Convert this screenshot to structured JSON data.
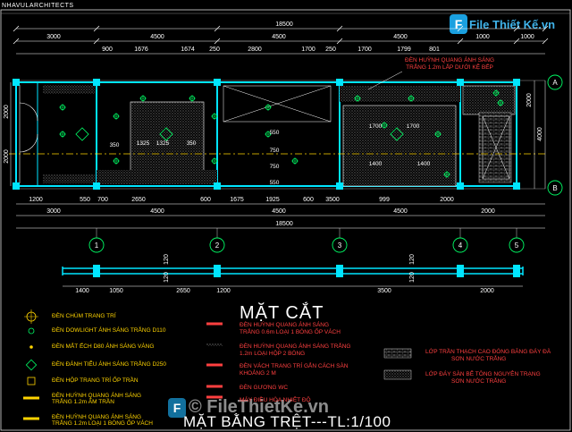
{
  "header": {
    "firm": "NHAVULARCHITECTS"
  },
  "logo": {
    "mark": "F",
    "text": "File Thiết Kế.vn"
  },
  "watermark": {
    "text": "© FileThietKe.vn",
    "mark": "F"
  },
  "titles": {
    "section": "MẶT CẮT",
    "plan": "MẶT BẰNG TRỆT---TL:1/100"
  },
  "note": {
    "line1": "ĐÈN HUỲNH QUANG ÁNH SÁNG",
    "line2": "TRẮNG 1.2m LẮP DƯỚI KỆ BẾP"
  },
  "dims": {
    "top_total": "18500",
    "top_row": [
      "3000",
      "4500",
      "4500",
      "4500",
      "1000",
      "1000"
    ],
    "top_sub": [
      "900",
      "1676",
      "1674",
      "250",
      "2800",
      "1700",
      "250",
      "1700",
      "1799",
      "801"
    ],
    "right": [
      "2000",
      "4000"
    ],
    "left": [
      "2000",
      "2000"
    ],
    "bot_row1": [
      "1200",
      "550",
      "700",
      "2650",
      "600",
      "1675",
      "1925",
      "600",
      "3500",
      "999",
      "2000"
    ],
    "bot_row2": [
      "3000",
      "4500",
      "4500",
      "4500",
      "2000"
    ],
    "bot_total": "18500",
    "inner": [
      "350",
      "1325",
      "1325",
      "350",
      "1700",
      "1700",
      "1400",
      "1400",
      "550",
      "750",
      "750",
      "550"
    ],
    "section_dims": [
      "1400",
      "1050",
      "2650",
      "1200",
      "3500",
      "2000"
    ],
    "section_vert": [
      "120",
      "120",
      "120",
      "120"
    ]
  },
  "axes": {
    "cols": [
      "1",
      "2",
      "3",
      "4",
      "5"
    ],
    "rows": [
      "A",
      "B"
    ]
  },
  "legend_left": [
    {
      "icon": "chandelier-icon",
      "text": "ĐÈN CHÙM TRANG TRÍ"
    },
    {
      "icon": "downlight-icon",
      "text": "ĐÈN DOWLIGHT ÁNH SÁNG TRẮNG D110"
    },
    {
      "icon": "spot-icon",
      "text": "ĐÈN MẮT ẾCH D80 ÁNH SÁNG VÀNG"
    },
    {
      "icon": "deco-icon",
      "text": "ĐÈN ĐÁNH TIỂU ÁNH SÁNG TRẮNG D250"
    },
    {
      "icon": "box-light-icon",
      "text": "ĐÈN HỘP TRANG TRÍ ỐP TRẦN"
    },
    {
      "icon": "fluorescent-icon",
      "text": "ĐÈN HUỲNH QUANG ÁNH SÁNG"
    },
    {
      "icon": "",
      "text": "TRẮNG 1.2m ÂM TRẦN"
    },
    {
      "icon": "fluorescent-wall-icon",
      "text": "ĐÈN HUỲNH QUANG ÁNH SÁNG"
    },
    {
      "icon": "",
      "text": "TRẮNG 1.2m LOẠI 1 BÓNG ỐP VÁCH"
    }
  ],
  "legend_mid": [
    {
      "text": "ĐÈN HUỲNH QUANG ÁNH SÁNG"
    },
    {
      "text": "TRẮNG 0.6m LOẠI 1 BÓNG ỐP VÁCH"
    },
    {
      "text": "ĐÈN HUỲNH QUANG ÁNH SÁNG TRẮNG"
    },
    {
      "text": "1.2m LOẠI HỘP 2 BÓNG"
    },
    {
      "text": "ĐÈN VÁCH TRANG TRÍ GẮN CÁCH SÀN"
    },
    {
      "text": "KHOẢNG 2 M"
    },
    {
      "text": "ĐÈN GƯƠNG WC"
    },
    {
      "text": "MÁY ĐIỀU HÒA NHIỆT ĐỘ"
    }
  ],
  "legend_right": [
    {
      "text": "LỚP TRẦN THẠCH CAO ĐÓNG BĂNG ĐÁY ĐÀ"
    },
    {
      "text": "SƠN NƯỚC TRẮNG"
    },
    {
      "text": "LỚP ĐÁY SÀN BÊ TÔNG NGUYÊN TRẠNG"
    },
    {
      "text": "SƠN NƯỚC TRẮNG"
    }
  ],
  "colors": {
    "wall": "#00e5ff",
    "dim": "#ffffff",
    "axis": "#ffd400",
    "dash": "#ff3030",
    "hatch": "#d8d8d8"
  }
}
